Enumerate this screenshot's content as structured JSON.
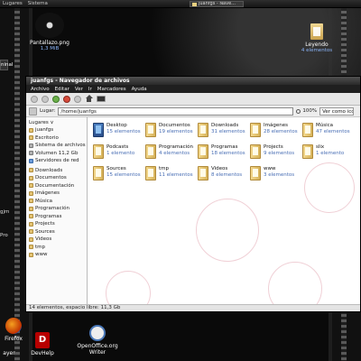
{
  "top_panel": {
    "menu": [
      "Lugares",
      "Sistema"
    ],
    "task_label": "juanfgs - Nave..."
  },
  "desktop": {
    "icons": [
      {
        "name": "Pantallazo.png",
        "sub": "1,3 MiB"
      },
      {
        "name": "Leyendo",
        "sub": "4 elementos"
      }
    ],
    "left_edge": [
      "ninal",
      "gjm",
      "Pro"
    ],
    "bottom_icons": [
      {
        "label": "Firefox"
      },
      {
        "label": "DevHelp",
        "glyph": "D"
      },
      {
        "label": "OpenOffice.org Writer"
      },
      {
        "label": "ayer"
      }
    ]
  },
  "window": {
    "title": "juanfgs - Navegador de archivos",
    "menu": [
      "Archivo",
      "Editar",
      "Ver",
      "Ir",
      "Marcadores",
      "Ayuda"
    ],
    "location_label": "Lugar:",
    "location_value": "/home/juanfgs",
    "zoom": "100%",
    "view_mode": "Ver como iconos",
    "sidebar_header": "Lugares ∨",
    "sidebar_items": [
      {
        "label": "juanfgs",
        "icon": "home-folder-icon"
      },
      {
        "label": "Escritorio",
        "icon": "desktop-icon"
      },
      {
        "label": "Sistema de archivos",
        "icon": "drive-icon"
      },
      {
        "label": "Volumen 11,2 Gb",
        "icon": "drive-icon"
      },
      {
        "label": "Servidores de red",
        "icon": "network-icon"
      },
      {
        "label": "Downloads",
        "icon": "folder-icon"
      },
      {
        "label": "Documentos",
        "icon": "folder-icon"
      },
      {
        "label": "Documentación",
        "icon": "folder-icon"
      },
      {
        "label": "Imágenes",
        "icon": "folder-icon"
      },
      {
        "label": "Música",
        "icon": "folder-icon"
      },
      {
        "label": "Programación",
        "icon": "folder-icon"
      },
      {
        "label": "Programas",
        "icon": "folder-icon"
      },
      {
        "label": "Projects",
        "icon": "folder-icon"
      },
      {
        "label": "Sources",
        "icon": "folder-icon"
      },
      {
        "label": "Videos",
        "icon": "folder-icon"
      },
      {
        "label": "tmp",
        "icon": "folder-icon"
      },
      {
        "label": "www",
        "icon": "folder-icon"
      }
    ],
    "files": [
      {
        "name": "Desktop",
        "count": "15 elementos"
      },
      {
        "name": "Documentos",
        "count": "19 elementos"
      },
      {
        "name": "Downloads",
        "count": "31 elementos"
      },
      {
        "name": "Imágenes",
        "count": "28 elementos"
      },
      {
        "name": "Música",
        "count": "47 elementos"
      },
      {
        "name": "Podcasts",
        "count": "1 elemento"
      },
      {
        "name": "Programación",
        "count": "4 elementos"
      },
      {
        "name": "Programas",
        "count": "18 elementos"
      },
      {
        "name": "Projects",
        "count": "9 elementos"
      },
      {
        "name": "slix",
        "count": "1 elemento"
      },
      {
        "name": "Sources",
        "count": "15 elementos"
      },
      {
        "name": "tmp",
        "count": "11 elementos"
      },
      {
        "name": "Videos",
        "count": "8 elementos"
      },
      {
        "name": "www",
        "count": "3 elementos"
      }
    ],
    "status": "14 elementos, espacio libre: 11,3 Gb"
  }
}
